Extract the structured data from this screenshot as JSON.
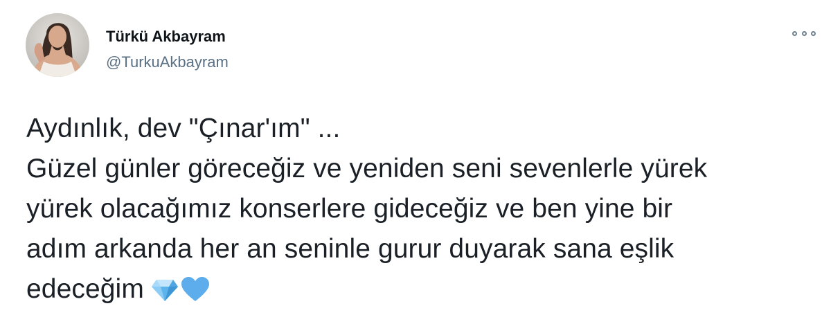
{
  "author": {
    "display_name": "Türkü Akbayram",
    "handle": "@TurkuAkbayram",
    "avatar_icon": "profile-photo"
  },
  "more_icon": "more-options-icon",
  "tweet": {
    "lines": [
      "Aydınlık, dev \"Çınar'ım\" ...",
      "Güzel günler göreceğiz ve yeniden seni sevenlerle yürek",
      "yürek olacağımız konserlere gideceğiz ve ben yine bir",
      "adım arkanda her an seninle gurur duyarak sana eşlik",
      "edeceğim"
    ],
    "emojis": [
      "gem-stone-emoji",
      "blue-heart-emoji"
    ]
  },
  "colors": {
    "name": "#0f1419",
    "handle": "#5b7083",
    "text": "#1a2026",
    "emoji_blue": "#5dadec"
  }
}
